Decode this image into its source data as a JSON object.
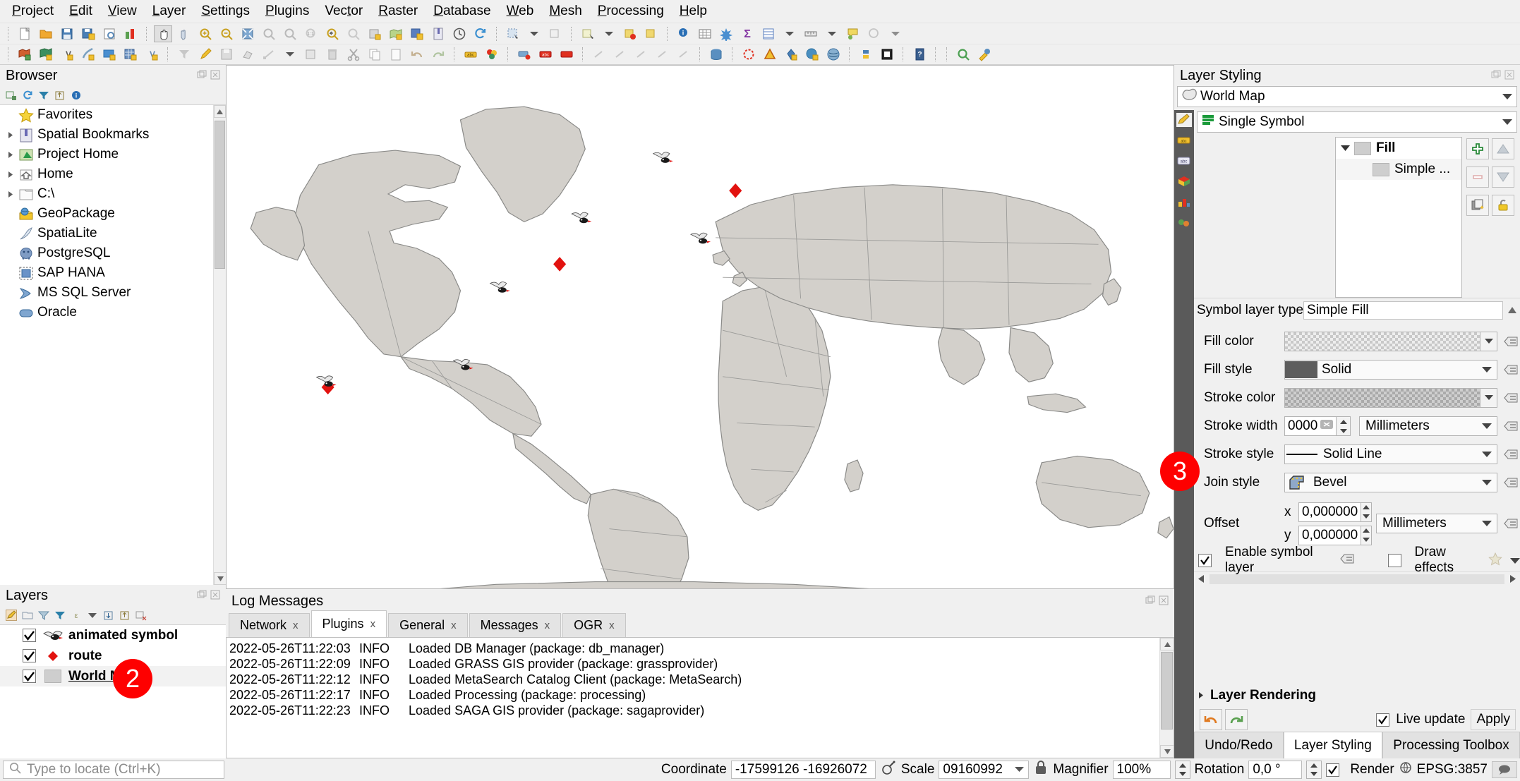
{
  "app": {
    "menus": [
      "Project",
      "Edit",
      "View",
      "Layer",
      "Settings",
      "Plugins",
      "Vector",
      "Raster",
      "Database",
      "Web",
      "Mesh",
      "Processing",
      "Help"
    ]
  },
  "browser": {
    "title": "Browser",
    "toolbar_icons": [
      "add-layer-icon",
      "refresh-icon",
      "filter-icon",
      "collapse-all-icon",
      "properties-icon"
    ],
    "items": [
      {
        "label": "Favorites",
        "icon": "star-icon",
        "expandable": false
      },
      {
        "label": "Spatial Bookmarks",
        "icon": "bookmark-icon",
        "expandable": true
      },
      {
        "label": "Project Home",
        "icon": "project-home-icon",
        "expandable": true
      },
      {
        "label": "Home",
        "icon": "home-icon",
        "expandable": true
      },
      {
        "label": "C:\\",
        "icon": "folder-icon",
        "expandable": true
      },
      {
        "label": "GeoPackage",
        "icon": "geopackage-icon",
        "expandable": false
      },
      {
        "label": "SpatiaLite",
        "icon": "spatialite-icon",
        "expandable": false
      },
      {
        "label": "PostgreSQL",
        "icon": "postgresql-icon",
        "expandable": false
      },
      {
        "label": "SAP HANA",
        "icon": "sap-hana-icon",
        "expandable": false
      },
      {
        "label": "MS SQL Server",
        "icon": "mssql-icon",
        "expandable": false
      },
      {
        "label": "Oracle",
        "icon": "oracle-icon",
        "expandable": false
      }
    ]
  },
  "layers": {
    "title": "Layers",
    "items": [
      {
        "label": "animated symbol",
        "checked": true,
        "symbol": "bird-icon",
        "selected": false
      },
      {
        "label": "route",
        "checked": true,
        "symbol": "red-diamond-icon",
        "selected": false
      },
      {
        "label": "World Map",
        "checked": true,
        "symbol": "gray-fill-icon",
        "selected": true
      }
    ]
  },
  "log": {
    "title": "Log Messages",
    "tabs": [
      {
        "label": "Network",
        "active": false
      },
      {
        "label": "Plugins",
        "active": true
      },
      {
        "label": "General",
        "active": false
      },
      {
        "label": "Messages",
        "active": false
      },
      {
        "label": "OGR",
        "active": false
      }
    ],
    "close_glyph": "x",
    "entries": [
      {
        "time": "2022-05-26T11:22:03",
        "level": "INFO",
        "message": "Loaded DB Manager (package: db_manager)"
      },
      {
        "time": "2022-05-26T11:22:09",
        "level": "INFO",
        "message": "Loaded GRASS GIS provider (package: grassprovider)"
      },
      {
        "time": "2022-05-26T11:22:12",
        "level": "INFO",
        "message": "Loaded MetaSearch Catalog Client (package: MetaSearch)"
      },
      {
        "time": "2022-05-26T11:22:17",
        "level": "INFO",
        "message": "Loaded Processing (package: processing)"
      },
      {
        "time": "2022-05-26T11:22:23",
        "level": "INFO",
        "message": "Loaded SAGA GIS provider (package: sagaprovider)"
      }
    ]
  },
  "layer_styling": {
    "title": "Layer Styling",
    "layer_combo": "World Map",
    "renderer_combo": "Single Symbol",
    "symbol_tree": [
      {
        "label": "Fill",
        "level": 0,
        "expanded": true
      },
      {
        "label": "Simple ...",
        "level": 1,
        "expanded": false
      }
    ],
    "list_buttons": [
      "add-symbol-layer-icon",
      "move-up-icon",
      "remove-symbol-layer-icon",
      "move-down-icon",
      "duplicate-icon",
      "lock-icon"
    ],
    "symbol_layer_type_label": "Symbol layer type",
    "symbol_layer_type_value": "Simple Fill",
    "properties": [
      {
        "label": "Fill color",
        "type": "color",
        "value": "",
        "transparent": true
      },
      {
        "label": "Fill style",
        "type": "select",
        "value": "Solid",
        "preview": "solid-fill-preview"
      },
      {
        "label": "Stroke color",
        "type": "color",
        "value": "",
        "transparent": true
      },
      {
        "label": "Stroke width",
        "type": "spin",
        "value": "0000",
        "unit": "Millimeters"
      },
      {
        "label": "Stroke style",
        "type": "select",
        "value": "Solid Line",
        "preview": "solid-line-preview"
      },
      {
        "label": "Join style",
        "type": "select",
        "value": "Bevel",
        "preview": "bevel-join-preview"
      }
    ],
    "offset_label": "Offset",
    "offset_x_label": "x",
    "offset_x_value": "0,000000",
    "offset_y_label": "y",
    "offset_y_value": "0,000000",
    "offset_unit": "Millimeters",
    "enable_symbol_layer_label": "Enable symbol layer",
    "enable_symbol_layer_checked": true,
    "draw_effects_label": "Draw effects",
    "draw_effects_checked": false,
    "layer_rendering_label": "Layer Rendering",
    "live_update_label": "Live update",
    "live_update_checked": true,
    "apply_label": "Apply",
    "bottom_tabs": [
      {
        "label": "Undo/Redo",
        "active": false
      },
      {
        "label": "Layer Styling",
        "active": true
      },
      {
        "label": "Processing Toolbox",
        "active": false
      }
    ]
  },
  "statusbar": {
    "locate_placeholder": "Type to locate (Ctrl+K)",
    "coordinate_label": "Coordinate",
    "coordinate_value": "-17599126 -16926072",
    "scale_label": "Scale",
    "scale_value": "09160992",
    "magnifier_label": "Magnifier",
    "magnifier_value": "100%",
    "rotation_label": "Rotation",
    "rotation_value": "0,0 °",
    "render_label": "Render",
    "render_checked": true,
    "crs_value": "EPSG:3857"
  },
  "annotations": [
    {
      "number": "2",
      "target": "layers-panel-world-map"
    },
    {
      "number": "3",
      "target": "layer-styling-properties"
    }
  ],
  "colors": {
    "annotation_red": "#fe0000",
    "map_land": "#d3d0cb",
    "map_border": "#8a8a88",
    "marker_red": "#e2120f",
    "panel_bg": "#f0f0f0",
    "strip_dark": "#5a5a5a"
  }
}
